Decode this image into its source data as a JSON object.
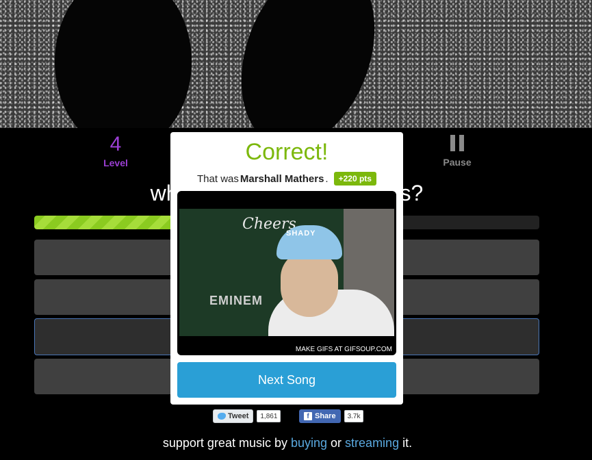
{
  "stats": {
    "level_value": "4",
    "level_label": "Level",
    "pause_label": "Pause"
  },
  "question": {
    "text_left": "wh",
    "text_right": "s?"
  },
  "progress": {
    "fraction": 0.73
  },
  "modal": {
    "title": "Correct!",
    "subtitle_prefix": "That was ",
    "artist": "Marshall Mathers",
    "subtitle_suffix": ".",
    "points_badge": "+220 pts",
    "gif_caption": "MAKE GIFS AT GIFSOUP.COM",
    "gif_poster_text": "Cheers",
    "gif_brand_text": "EMINEM",
    "gif_cap_text": "SHADY",
    "next_button": "Next Song"
  },
  "social": {
    "tweet_label": "Tweet",
    "tweet_count": "1,861",
    "share_label": "Share",
    "share_count": "3.7k"
  },
  "footer": {
    "prefix": "support great music by ",
    "buying": "buying",
    "middle": " or ",
    "streaming": "streaming",
    "suffix": " it."
  },
  "colors": {
    "accent_purple": "#9b3fd4",
    "correct_green": "#7cb80c",
    "button_blue": "#2a9fd6",
    "link_blue": "#5aa9e0"
  }
}
